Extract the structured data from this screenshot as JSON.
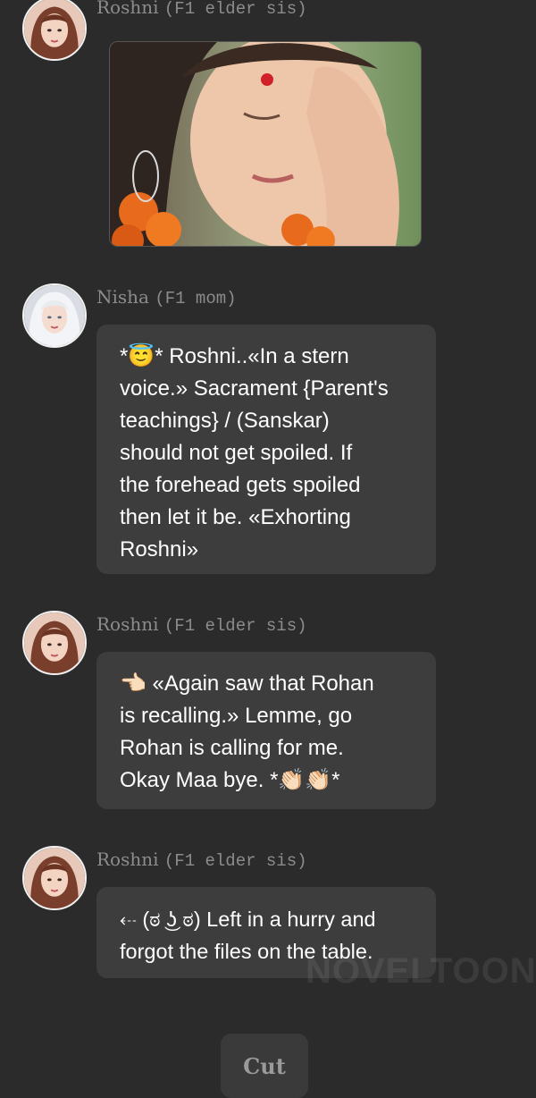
{
  "messages": [
    {
      "sender": "Roshni",
      "role": "(F1 elder sis)",
      "type": "image",
      "image": "woman-applying-bindi-photo"
    },
    {
      "sender": "Nisha",
      "role": "(F1 mom)",
      "type": "text",
      "lines": [
        "*😇* Roshni..«In a stern",
        "voice.» Sacrament {Parent's",
        "teachings} / (Sanskar)",
        "should not get spoiled. If",
        "the forehead gets spoiled",
        "then let it be. «Exhorting",
        "Roshni»"
      ]
    },
    {
      "sender": "Roshni",
      "role": "(F1 elder sis)",
      "type": "text",
      "lines": [
        "👈🏻 «Again saw that Rohan",
        "is recalling.» Lemme, go",
        "Rohan is calling for me.",
        "Okay Maa bye. *👏🏻👏🏻*"
      ]
    },
    {
      "sender": "Roshni",
      "role": "(F1 elder sis)",
      "type": "text",
      "lines": [
        "⇠ (ಠ ͜ʖ ಠ) Left in a hurry and",
        "forgot the files on the table."
      ]
    }
  ],
  "watermark": "NOVELTOON",
  "cut_label": "Cut",
  "colors": {
    "background": "#2b2b2b",
    "bubble": "#3d3d3d",
    "name_text": "#8c8c8c",
    "message_text": "#ffffff"
  }
}
